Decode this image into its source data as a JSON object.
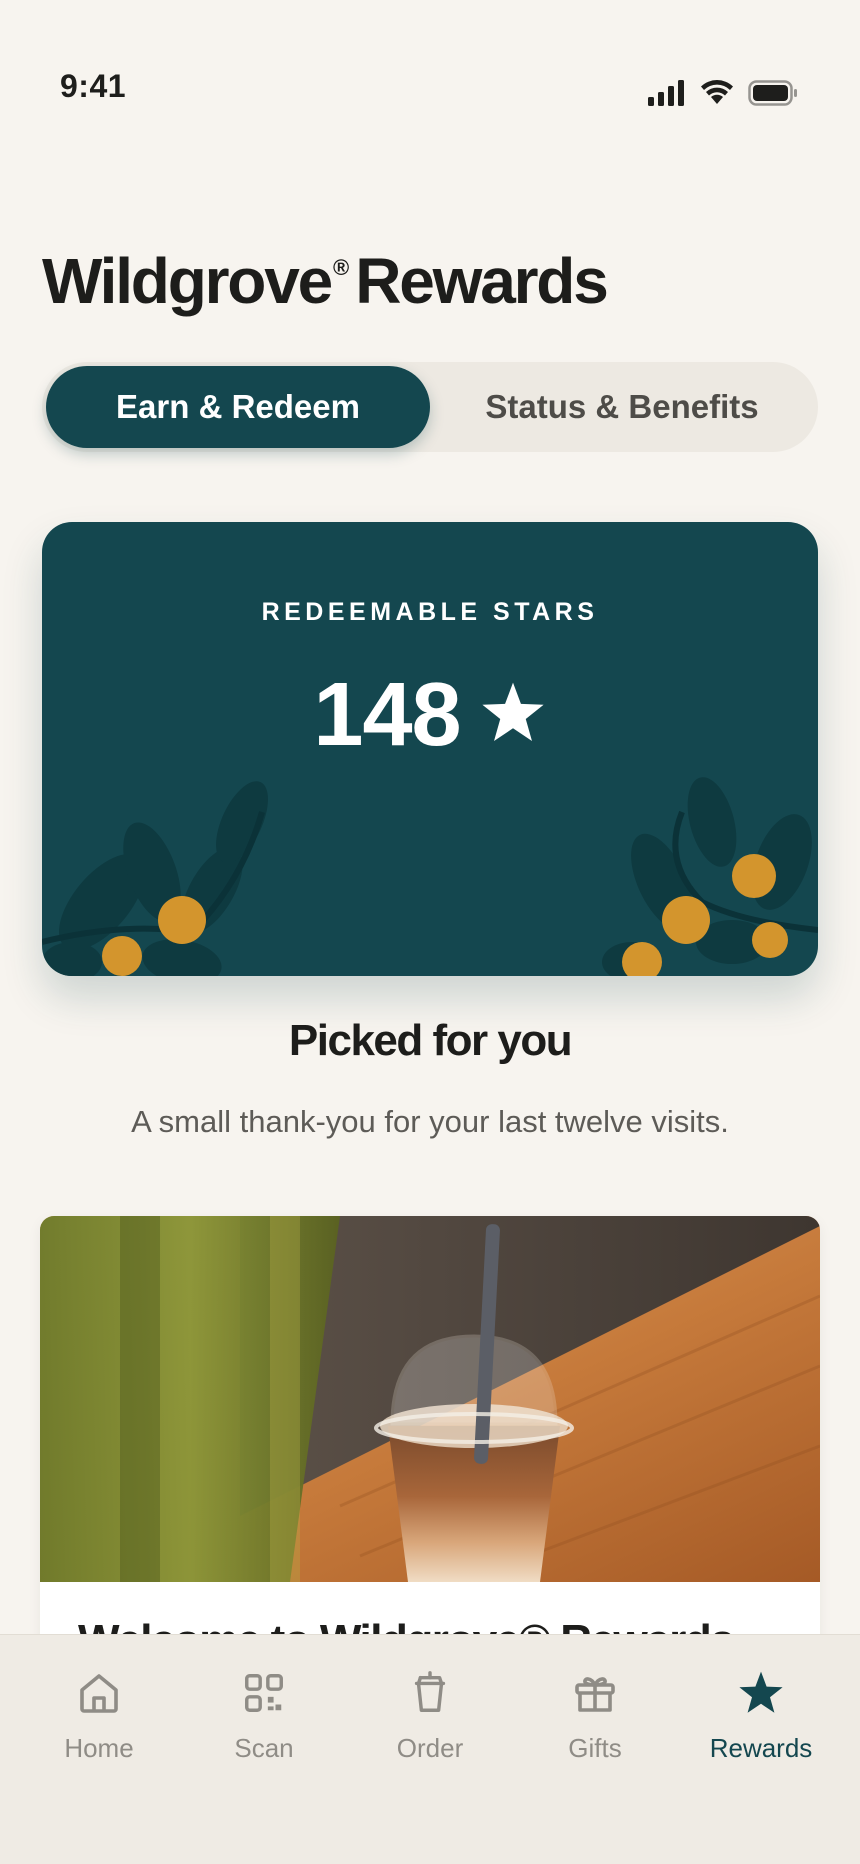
{
  "status_bar": {
    "time": "9:41",
    "icons": [
      "cellular-signal-icon",
      "wifi-icon",
      "battery-icon"
    ]
  },
  "header": {
    "title_brand": "Wildgrove",
    "title_mark": "®",
    "title_rest": "Rewards"
  },
  "segmented": {
    "tabs": [
      {
        "label": "Earn & Redeem",
        "selected": true
      },
      {
        "label": "Status & Benefits",
        "selected": false
      }
    ]
  },
  "stars_card": {
    "label": "REDEEMABLE STARS",
    "value": "148",
    "icon": "star-icon"
  },
  "picked": {
    "title": "Picked for you",
    "subtitle": "A small thank-you for your last twelve visits."
  },
  "offer": {
    "title": "Welcome to Wildgrove® Rewards",
    "image": "iced-coffee-photo"
  },
  "tab_bar": {
    "items": [
      {
        "label": "Home",
        "icon": "home-icon",
        "active": false
      },
      {
        "label": "Scan",
        "icon": "scan-icon",
        "active": false
      },
      {
        "label": "Order",
        "icon": "cup-icon",
        "active": false
      },
      {
        "label": "Gifts",
        "icon": "gift-icon",
        "active": false
      },
      {
        "label": "Rewards",
        "icon": "star-icon",
        "active": true
      }
    ]
  },
  "colors": {
    "background": "#f7f4ef",
    "accent": "#14474f",
    "gold": "#d3952d",
    "inactive": "#8f8c86"
  }
}
